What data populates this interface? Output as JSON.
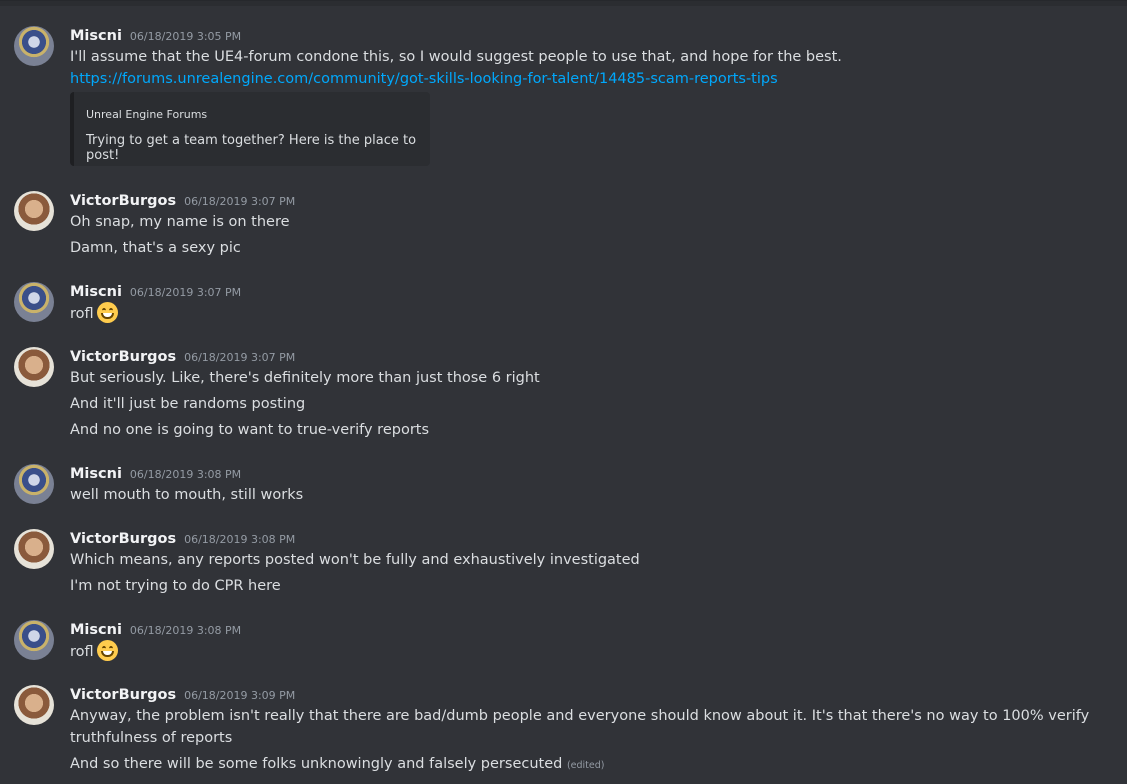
{
  "messages": [
    {
      "author": "Miscni",
      "timestamp": "06/18/2019 3:05 PM",
      "lines": [
        "I'll assume that the UE4-forum condone this, so I would suggest people to use that, and hope for the best."
      ],
      "link": "https://forums.unrealengine.com/community/got-skills-looking-for-talent/14485-scam-reports-tips",
      "embed": {
        "provider": "Unreal Engine Forums",
        "description": "Trying to get a team together? Here is the place to post!"
      }
    },
    {
      "author": "VictorBurgos",
      "timestamp": "06/18/2019 3:07 PM",
      "lines": [
        "Oh snap, my name is on there",
        "Damn, that's a sexy pic"
      ]
    },
    {
      "author": "Miscni",
      "timestamp": "06/18/2019 3:07 PM",
      "lines": [
        "rofl"
      ],
      "emoji": "grinning-smile"
    },
    {
      "author": "VictorBurgos",
      "timestamp": "06/18/2019 3:07 PM",
      "lines": [
        "But seriously. Like, there's definitely more than just those 6 right",
        "And it'll just be randoms posting",
        "And no one is going to want to true-verify reports"
      ]
    },
    {
      "author": "Miscni",
      "timestamp": "06/18/2019 3:08 PM",
      "lines": [
        "well mouth to mouth, still works"
      ]
    },
    {
      "author": "VictorBurgos",
      "timestamp": "06/18/2019 3:08 PM",
      "lines": [
        "Which means, any reports posted won't be fully and exhaustively investigated",
        "I'm not trying to do CPR here"
      ]
    },
    {
      "author": "Miscni",
      "timestamp": "06/18/2019 3:08 PM",
      "lines": [
        "rofl"
      ],
      "emoji": "grinning-smile"
    },
    {
      "author": "VictorBurgos",
      "timestamp": "06/18/2019 3:09 PM",
      "lines": [
        "Anyway, the problem isn't really that there are bad/dumb people and everyone should know about it. It's that there's no way to 100% verify truthfulness of reports",
        "And so there will be some folks unknowingly and falsely persecuted"
      ],
      "edited_label": "(edited)"
    }
  ]
}
